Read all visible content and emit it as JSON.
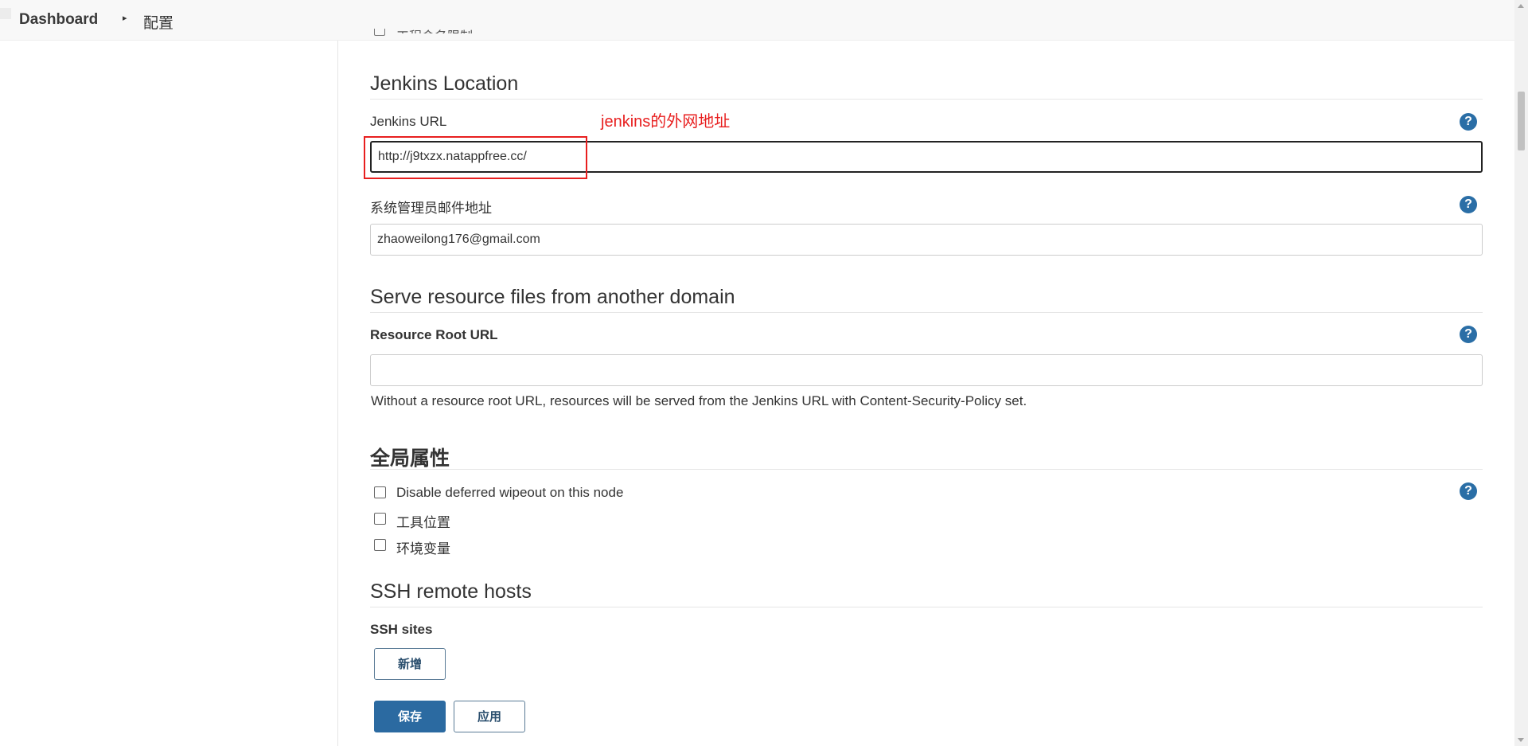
{
  "breadcrumb": {
    "home": "Dashboard",
    "separator": "▸",
    "current": "配置"
  },
  "cut_off_row": {
    "label": "工程命名限制"
  },
  "jenkins_location": {
    "title": "Jenkins Location",
    "url_label": "Jenkins URL",
    "url_value": "http://j9txzx.natappfree.cc/",
    "email_label": "系统管理员邮件地址",
    "email_value": "zhaoweilong176@gmail.com"
  },
  "annotation": {
    "text": "jenkins的外网地址",
    "color": "#e81f1f"
  },
  "resource_domain": {
    "title": "Serve resource files from another domain",
    "root_url_label": "Resource Root URL",
    "root_url_value": "",
    "note": "Without a resource root URL, resources will be served from the Jenkins URL with Content-Security-Policy set."
  },
  "global_properties": {
    "title": "全局属性",
    "options": [
      {
        "label": "Disable deferred wipeout on this node",
        "checked": false
      },
      {
        "label": "工具位置",
        "checked": false
      },
      {
        "label": "环境变量",
        "checked": false
      }
    ]
  },
  "ssh": {
    "title": "SSH remote hosts",
    "sites_label": "SSH sites",
    "add_button": "新增"
  },
  "actions": {
    "save": "保存",
    "apply": "应用"
  },
  "help_glyph": "?",
  "colors": {
    "primary": "#2b6aa1",
    "help": "#2a6ea6",
    "annotation": "#e81f1f"
  }
}
